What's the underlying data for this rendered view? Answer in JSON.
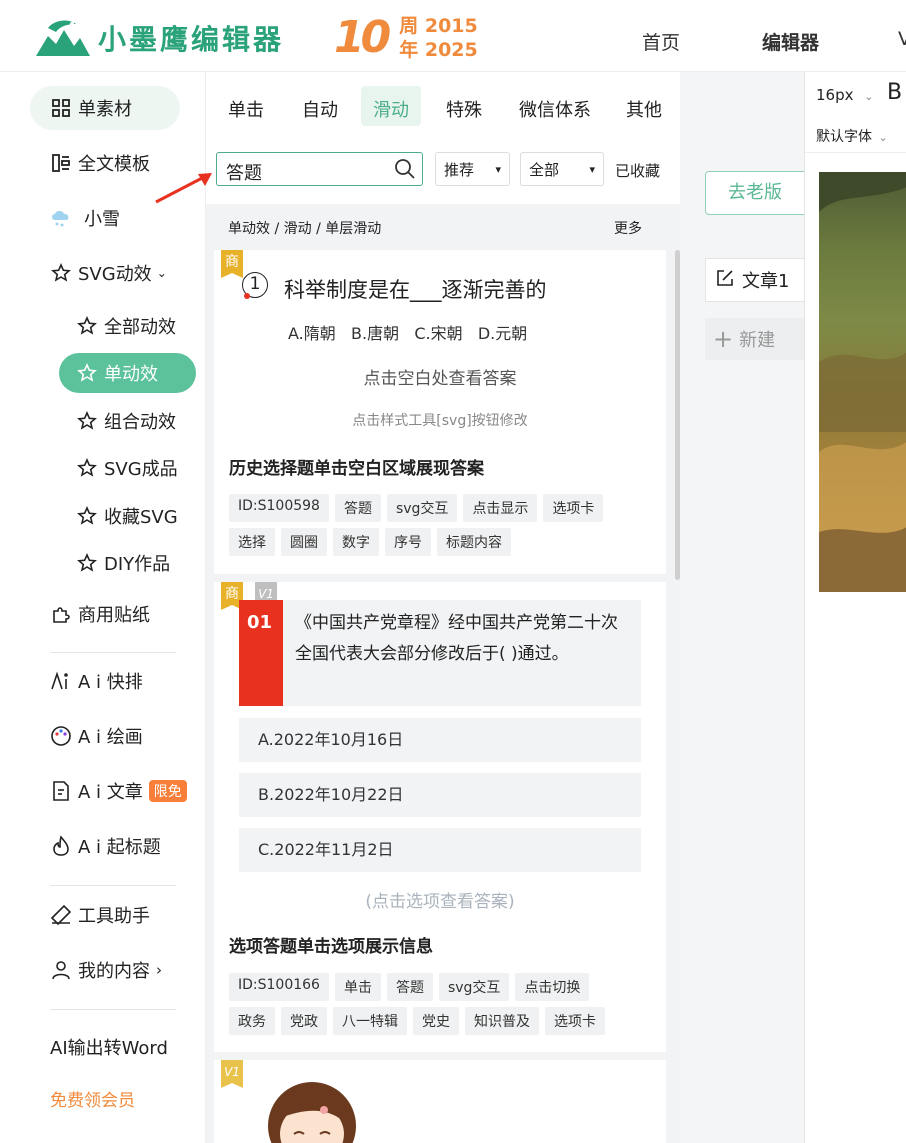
{
  "header": {
    "logo_text": "小墨鹰编辑器",
    "anniv_number": "10",
    "anniv_line1": "周 2015",
    "anniv_line2": "年 2025",
    "nav": [
      "首页",
      "编辑器",
      "V"
    ]
  },
  "sidebar": {
    "items": [
      {
        "label": "单素材",
        "icon": "grid-icon"
      },
      {
        "label": "全文模板",
        "icon": "template-icon"
      },
      {
        "label": "小雪",
        "icon": "snow-cloud-icon"
      },
      {
        "label": "SVG动效",
        "icon": "star-icon"
      },
      {
        "label": "全部动效",
        "icon": "star-icon"
      },
      {
        "label": "单动效",
        "icon": "star-icon"
      },
      {
        "label": "组合动效",
        "icon": "star-icon"
      },
      {
        "label": "SVG成品",
        "icon": "star-icon"
      },
      {
        "label": "收藏SVG",
        "icon": "star-icon"
      },
      {
        "label": "DIY作品",
        "icon": "star-icon"
      },
      {
        "label": "商用贴纸",
        "icon": "puzzle-icon"
      },
      {
        "label": "A i 快排",
        "icon": "ai-icon"
      },
      {
        "label": "A i 绘画",
        "icon": "palette-icon"
      },
      {
        "label": "A i 文章",
        "icon": "document-icon",
        "badge": "限免"
      },
      {
        "label": "A i 起标题",
        "icon": "flame-icon"
      },
      {
        "label": "工具助手",
        "icon": "ruler-icon"
      },
      {
        "label": "我的内容",
        "icon": "user-icon"
      },
      {
        "label": "AI输出转Word"
      },
      {
        "label": "免费领会员"
      }
    ]
  },
  "panel": {
    "tabs": [
      "单击",
      "自动",
      "滑动",
      "特殊",
      "微信体系",
      "其他"
    ],
    "active_tab": "滑动",
    "search_value": "答题",
    "sort": "推荐",
    "filter": "全部",
    "favorites": "已收藏",
    "breadcrumb": "单动效 / 滑动 / 单层滑动",
    "more": "更多"
  },
  "cards": [
    {
      "corner": "商",
      "number": "1",
      "question": "科举制度是在___逐渐完善的",
      "options": "A.隋朝   B.唐朝   C.宋朝   D.元朝",
      "hint": "点击空白处查看答案",
      "tip": "点击样式工具[svg]按钮修改",
      "title": "历史选择题单击空白区域展现答案",
      "tags": [
        [
          "ID:S100598",
          "答题",
          "svg交互",
          "点击显示",
          "选项卡"
        ],
        [
          "选择",
          "圆圈",
          "数字",
          "序号",
          "标题内容"
        ]
      ]
    },
    {
      "corner": "商",
      "version": "V1",
      "number": "01",
      "question": "《中国共产党章程》经中国共产党第二十次全国代表大会部分修改后于( )通过。",
      "options": [
        "A.2022年10月16日",
        "B.2022年10月22日",
        "C.2022年11月2日"
      ],
      "hint": "(点击选项查看答案)",
      "title": "选项答题单击选项展示信息",
      "tags": [
        [
          "ID:S100166",
          "单击",
          "答题",
          "svg交互",
          "点击切换"
        ],
        [
          "政务",
          "党政",
          "八一特辑",
          "党史",
          "知识普及",
          "选项卡"
        ]
      ]
    },
    {
      "version": "V1"
    }
  ],
  "right": {
    "old_version": "去老版",
    "doc": "文章1",
    "new": "新建",
    "font_size": "16px",
    "bold": "B",
    "font": "默认字体"
  },
  "colors": {
    "brand": "#2aa27a",
    "active": "#5cc29c",
    "orange": "#f08a3c",
    "red": "#e8321f"
  }
}
